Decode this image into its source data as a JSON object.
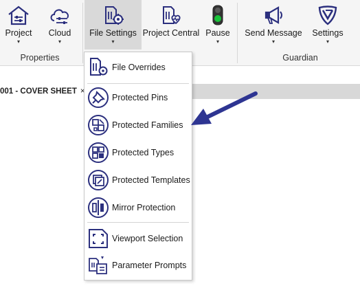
{
  "ribbon": {
    "buttons": [
      {
        "label": "Project",
        "icon": "project-house-icon",
        "has_dropdown": true
      },
      {
        "label": "Cloud",
        "icon": "cloud-sliders-icon",
        "has_dropdown": true
      },
      {
        "label": "File Settings",
        "icon": "file-settings-icon",
        "has_dropdown": true,
        "active": true
      },
      {
        "label": "Project Central",
        "icon": "project-central-icon",
        "has_dropdown": false
      },
      {
        "label": "Pause",
        "icon": "traffic-light-icon",
        "has_dropdown": true
      },
      {
        "label": "Send Message",
        "icon": "megaphone-icon",
        "has_dropdown": true
      },
      {
        "label": "Settings",
        "icon": "guardian-shield-icon",
        "has_dropdown": true
      }
    ],
    "groups": {
      "properties": "Properties",
      "guardian": "Guardian"
    },
    "dropdown_glyph": "▾"
  },
  "view_tab": {
    "title": "001 - COVER SHEET",
    "close_glyph": "×"
  },
  "file_settings_menu": {
    "items": [
      {
        "label": "File Overrides",
        "icon": "file-overrides-icon"
      },
      {
        "label": "Protected Pins",
        "icon": "pin-icon"
      },
      {
        "label": "Protected Families",
        "icon": "families-icon"
      },
      {
        "label": "Protected Types",
        "icon": "types-grid-icon"
      },
      {
        "label": "Protected Templates",
        "icon": "templates-icon"
      },
      {
        "label": "Mirror Protection",
        "icon": "mirror-icon"
      },
      {
        "label": "Viewport Selection",
        "icon": "viewport-icon"
      },
      {
        "label": "Parameter Prompts",
        "icon": "parameter-prompts-icon"
      }
    ]
  },
  "colors": {
    "icon_navy": "#2b2f7e",
    "annotation_arrow": "#2e3592",
    "ribbon_bg": "#f5f5f5",
    "active_button_bg": "#d9d9d9",
    "traffic_green": "#19c43a"
  }
}
